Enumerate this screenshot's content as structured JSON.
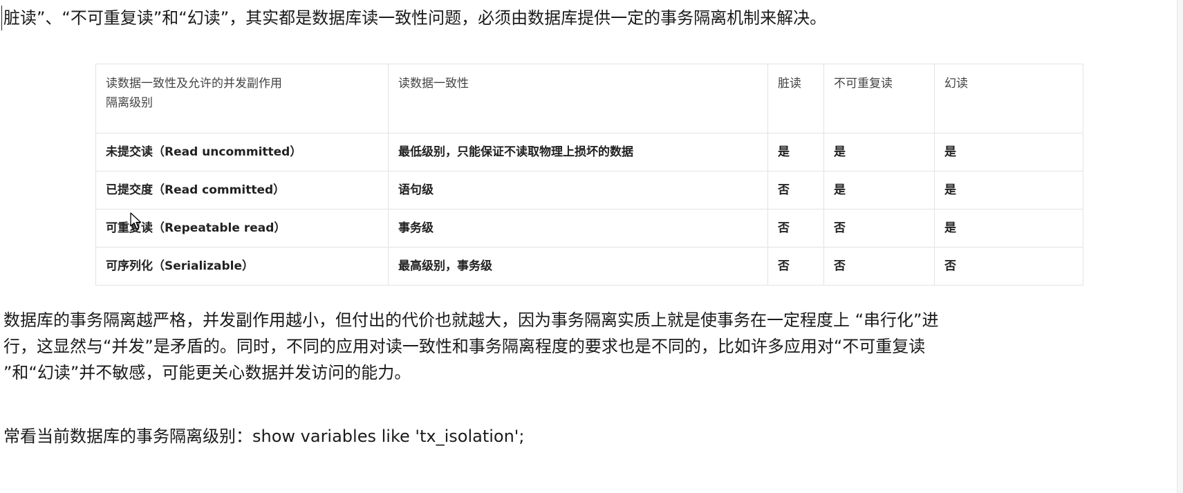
{
  "intro": "脏读”、“不可重复读”和“幻读”，其实都是数据库读一致性问题，必须由数据库提供一定的事务隔离机制来解决。",
  "table": {
    "header": {
      "level_line1": "读数据一致性及允许的并发副作用",
      "level_line2": "隔离级别",
      "consistency": "读数据一致性",
      "dirty": "脏读",
      "nonrepeatable": "不可重复读",
      "phantom": "幻读"
    },
    "rows": [
      {
        "level": "未提交读（Read uncommitted）",
        "consistency": "最低级别，只能保证不读取物理上损坏的数据",
        "dirty": "是",
        "nonrepeatable": "是",
        "phantom": "是"
      },
      {
        "level": "已提交度（Read committed）",
        "consistency": "语句级",
        "dirty": "否",
        "nonrepeatable": "是",
        "phantom": "是"
      },
      {
        "level": "可重复读（Repeatable read）",
        "consistency": "事务级",
        "dirty": "否",
        "nonrepeatable": "否",
        "phantom": "是"
      },
      {
        "level": "可序列化（Serializable）",
        "consistency": "最高级别，事务级",
        "dirty": "否",
        "nonrepeatable": "否",
        "phantom": "否"
      }
    ]
  },
  "body": {
    "line1": "数据库的事务隔离越严格，并发副作用越小，但付出的代价也就越大，因为事务隔离实质上就是使事务在一定程度上 “串行化”进",
    "line2": "行，这显然与“并发”是矛盾的。同时，不同的应用对读一致性和事务隔离程度的要求也是不同的，比如许多应用对“不可重复读",
    "line3": "”和“幻读”并不敏感，可能更关心数据并发访问的能力。"
  },
  "sql_line": "常看当前数据库的事务隔离级别：show variables like 'tx_isolation';",
  "icons": {
    "mouse_cursor": "arrow-pointer-icon"
  }
}
